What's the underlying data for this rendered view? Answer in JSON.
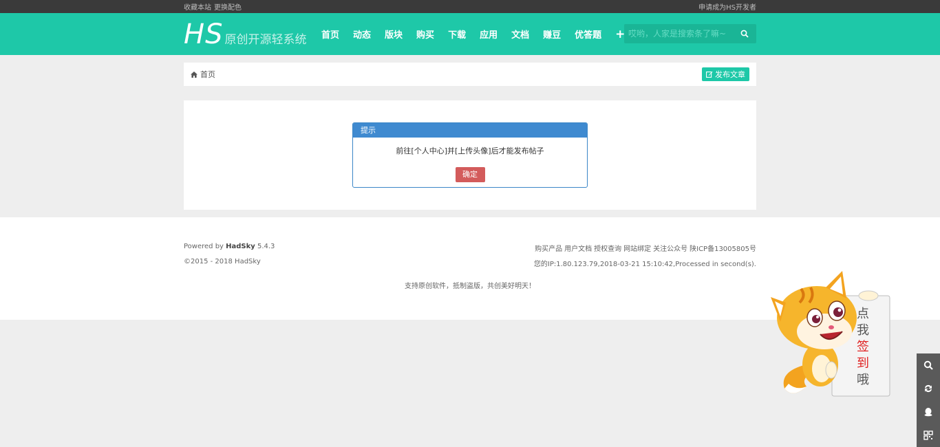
{
  "topbar": {
    "favorite": "收藏本站",
    "change_color": "更换配色",
    "apply_dev": "申请成为HS开发者"
  },
  "header": {
    "logo_text": "HS",
    "logo_tagline": "原创开源轻系统",
    "nav": [
      "首页",
      "动态",
      "版块",
      "购买",
      "下载",
      "应用",
      "文档",
      "赚豆",
      "优答题"
    ],
    "plus": "+",
    "search_placeholder": "哎哟，人家是搜索条了嘛~",
    "accent": "#1ec8a8"
  },
  "breadcrumb": {
    "home": "首页",
    "publish": "发布文章"
  },
  "dialog": {
    "title": "提示",
    "message": "前往[个人中心]并[上传头像]后才能发布帖子",
    "confirm": "确定"
  },
  "footer": {
    "powered_prefix": "Powered by ",
    "powered_name": "HadSky",
    "powered_version": " 5.4.3",
    "copyright": "©2015 - 2018 HadSky",
    "links": [
      "购买产品",
      "用户文档",
      "授权查询",
      "网站绑定",
      "关注公众号",
      "陕ICP备13005805号"
    ],
    "ip_info": "您的IP:1.80.123.79,2018-03-21 15:10:42,Processed in second(s).",
    "slogan": "支持原创软件，抵制盗版，共创美好明天！"
  },
  "mascot": {
    "sign": [
      "点",
      "我",
      "签",
      "到",
      "哦"
    ]
  },
  "side_tools": [
    "search-icon",
    "refresh-icon",
    "qq-icon",
    "qrcode-icon"
  ]
}
